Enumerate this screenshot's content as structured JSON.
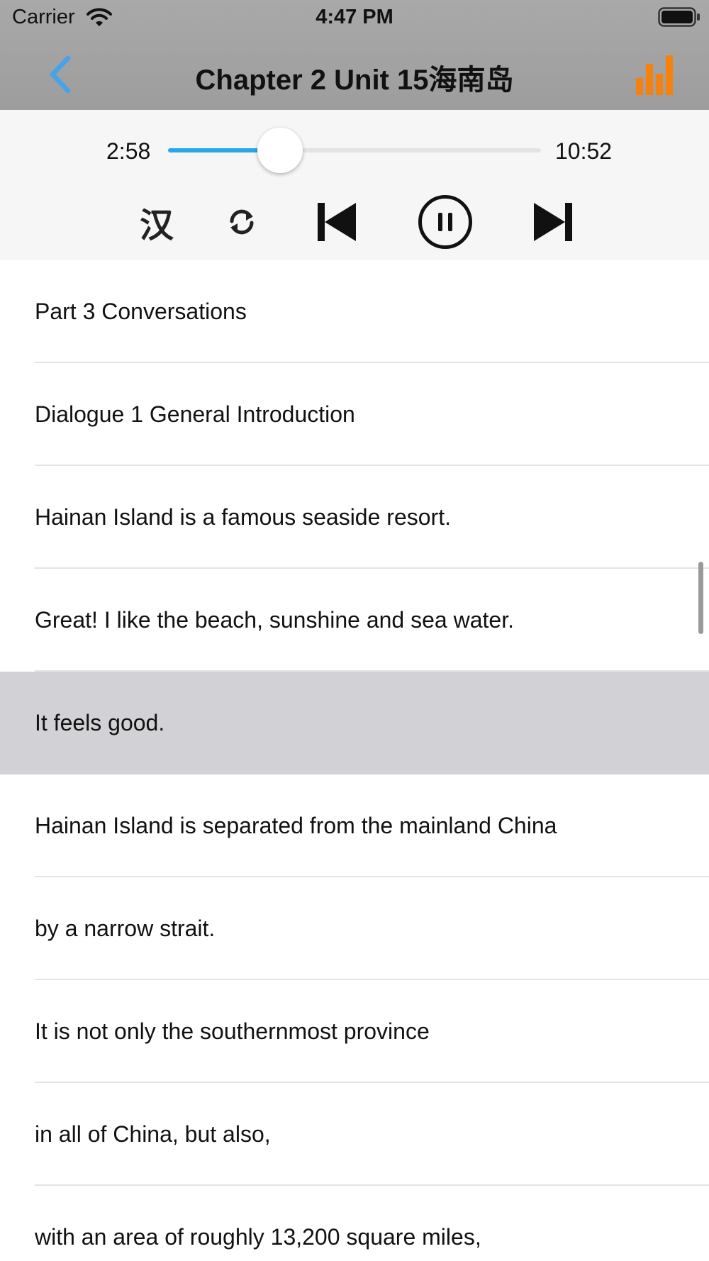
{
  "status_bar": {
    "carrier": "Carrier",
    "time": "4:47 PM"
  },
  "nav": {
    "title": "Chapter 2 Unit 15海南岛",
    "back_icon": "chevron-left-icon",
    "stats_icon": "bar-chart-icon",
    "accent_color": "#4aa3e6",
    "stats_color": "#f5820f"
  },
  "player": {
    "current_time": "2:58",
    "total_time": "10:52",
    "progress_fraction": 0.3,
    "progress_color": "#2aa7e8",
    "chinese_toggle_label": "汉",
    "controls": [
      "chinese-toggle",
      "repeat-icon",
      "previous-track-icon",
      "pause-icon",
      "next-track-icon"
    ]
  },
  "transcript": {
    "lines": [
      "Part 3 Conversations",
      "Dialogue 1 General Introduction",
      "Hainan Island is a famous seaside resort.",
      "Great! I like the beach, sunshine and sea water.",
      "It feels good.",
      "Hainan Island is separated from the mainland China",
      "by a narrow strait.",
      "It is not only the southernmost province",
      "in all of China, but also,",
      "with an area of roughly 13,200 square miles,"
    ],
    "selected_index": 4
  }
}
